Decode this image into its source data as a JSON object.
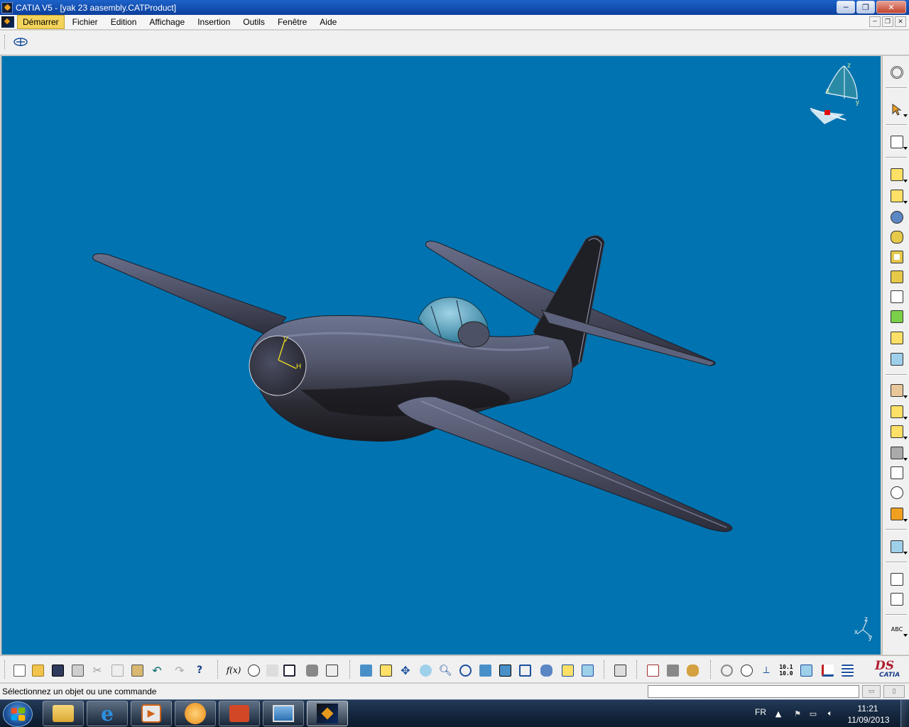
{
  "window": {
    "title": "CATIA V5 - [yak 23 aasembly.CATProduct]",
    "minimize_label": "─",
    "restore_label": "❐",
    "close_label": "✕"
  },
  "menubar": {
    "items": [
      {
        "label": "Démarrer"
      },
      {
        "label": "Fichier"
      },
      {
        "label": "Edition"
      },
      {
        "label": "Affichage"
      },
      {
        "label": "Insertion"
      },
      {
        "label": "Outils"
      },
      {
        "label": "Fenêtre"
      },
      {
        "label": "Aide"
      }
    ],
    "mdi_minimize": "─",
    "mdi_restore": "❐",
    "mdi_close": "✕"
  },
  "compass": {
    "axis_x": "x",
    "axis_y": "y",
    "axis_z": "z"
  },
  "model": {
    "axis_label_v": "V",
    "axis_label_h": "H"
  },
  "triad": {
    "axis_x": "x",
    "axis_y": "y",
    "axis_z": "z"
  },
  "right_toolbar": {
    "abc_label": "ABC"
  },
  "bottom_toolbar": {
    "formula_label": "f(x)",
    "scale_label_top": "10.1",
    "scale_label_bottom": "10.0"
  },
  "logo": {
    "ds": "DS",
    "word": "CATIA"
  },
  "statusbar": {
    "message": "Sélectionnez un objet ou une commande",
    "command_value": ""
  },
  "taskbar": {
    "language": "FR",
    "time": "11:21",
    "date": "11/09/2013"
  },
  "colors": {
    "viewport_bg": "#0073b0",
    "titlebar": "#1c62c9",
    "menu_highlight": "#f4d35b",
    "aircraft_body": "#3b3d52"
  }
}
